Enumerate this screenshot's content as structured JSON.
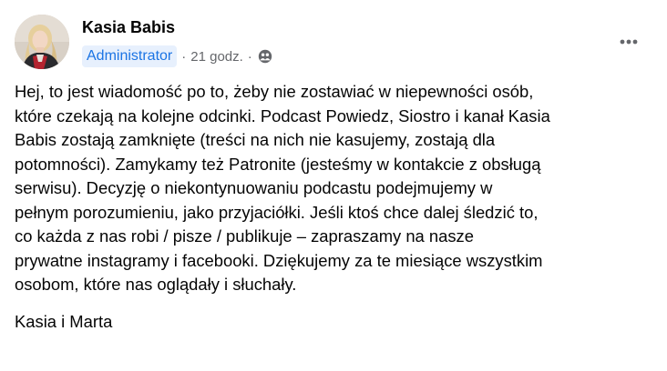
{
  "author": {
    "name": "Kasia Babis",
    "role": "Administrator",
    "time": "21 godz.",
    "separator": "·",
    "privacy_icon": "friends-globe-icon"
  },
  "menu": {
    "more_icon": "more-horizontal-icon",
    "more_symbol": "•••"
  },
  "post": {
    "paragraph": "Hej, to jest wiadomość po to, żeby nie zostawiać w niepewności osób,\nktóre czekają na kolejne odcinki. Podcast Powiedz, Siostro i kanał Kasia\nBabis zostają zamknięte (treści na nich nie kasujemy, zostają dla\npotomności). Zamykamy też Patronite (jesteśmy w kontakcie z obsługą\nserwisu). Decyzję o niekontynuowaniu podcastu podejmujemy w\npełnym porozumieniu, jako przyjaciółki. Jeśli ktoś chce dalej śledzić to,\nco każda z nas robi / pisze / publikuje – zapraszamy na nasze\nprywatne instagramy i facebooki. Dziękujemy za te miesiące wszystkim\nosobom, które nas oglądały i słuchały.",
    "signature": "Kasia i Marta"
  },
  "colors": {
    "badge_bg": "#e7f0fd",
    "badge_text": "#1b74e4",
    "meta_text": "#65676b",
    "body_text": "#050505"
  }
}
